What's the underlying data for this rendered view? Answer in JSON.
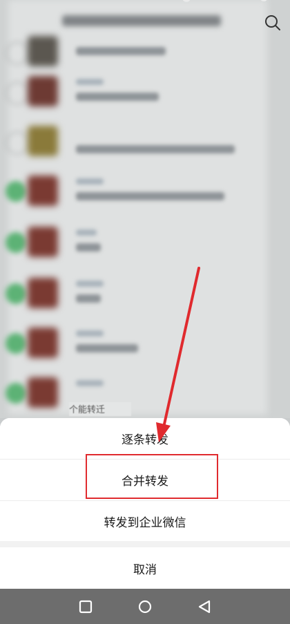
{
  "action_sheet": {
    "options": [
      {
        "label": "逐条转发"
      },
      {
        "label": "合并转发"
      },
      {
        "label": "转发到企业微信"
      }
    ],
    "cancel_label": "取消"
  },
  "background": {
    "fragment_text": "个能转迁"
  },
  "annotations": {
    "highlight_color": "#e02a2e",
    "highlighted_option": "合并转发"
  },
  "navbar": {
    "icons": [
      "square-icon",
      "circle-icon",
      "back-triangle-icon"
    ]
  }
}
